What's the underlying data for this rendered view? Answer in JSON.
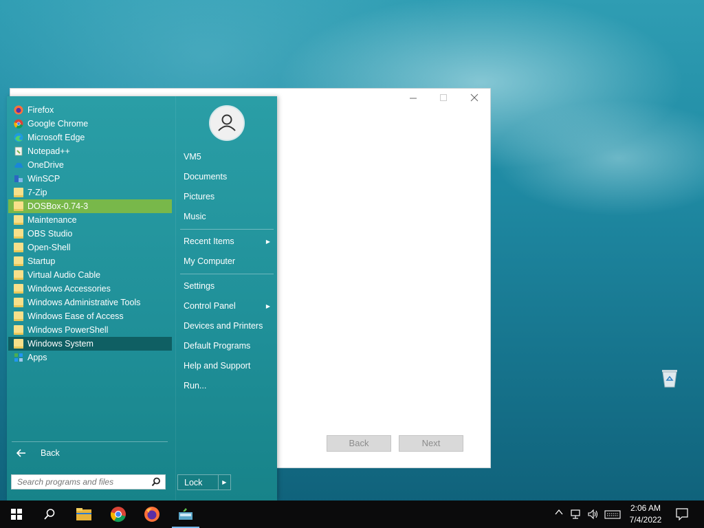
{
  "wizard": {
    "title": "",
    "back_label": "Back",
    "next_label": "Next"
  },
  "start_menu": {
    "programs": [
      {
        "label": "Firefox",
        "icon": "firefox-icon"
      },
      {
        "label": "Google Chrome",
        "icon": "chrome-icon"
      },
      {
        "label": "Microsoft Edge",
        "icon": "edge-icon"
      },
      {
        "label": "Notepad++",
        "icon": "notepad-plus-plus-icon"
      },
      {
        "label": "OneDrive",
        "icon": "onedrive-icon"
      },
      {
        "label": "WinSCP",
        "icon": "winscp-icon"
      },
      {
        "label": "7-Zip",
        "icon": "folder-icon"
      },
      {
        "label": "DOSBox-0.74-3",
        "icon": "folder-icon",
        "state": "highlighted"
      },
      {
        "label": "Maintenance",
        "icon": "folder-icon"
      },
      {
        "label": "OBS Studio",
        "icon": "folder-icon"
      },
      {
        "label": "Open-Shell",
        "icon": "folder-icon"
      },
      {
        "label": "Startup",
        "icon": "folder-icon"
      },
      {
        "label": "Virtual Audio Cable",
        "icon": "folder-icon"
      },
      {
        "label": "Windows Accessories",
        "icon": "folder-icon"
      },
      {
        "label": "Windows Administrative Tools",
        "icon": "folder-icon"
      },
      {
        "label": "Windows Ease of Access",
        "icon": "folder-icon"
      },
      {
        "label": "Windows PowerShell",
        "icon": "folder-icon"
      },
      {
        "label": "Windows System",
        "icon": "folder-icon",
        "state": "selected"
      },
      {
        "label": "Apps",
        "icon": "apps-icon"
      }
    ],
    "back_label": "Back",
    "search_placeholder": "Search programs and files",
    "right": {
      "user": "VM5",
      "documents": "Documents",
      "pictures": "Pictures",
      "music": "Music",
      "recent_items": "Recent Items",
      "my_computer": "My Computer",
      "settings": "Settings",
      "control_panel": "Control Panel",
      "devices_printers": "Devices and Printers",
      "default_programs": "Default Programs",
      "help_support": "Help and Support",
      "run": "Run..."
    },
    "lock_label": "Lock"
  },
  "taskbar": {
    "time": "2:06 AM",
    "date": "7/4/2022"
  },
  "colors": {
    "menu_bg": "#1f8f98",
    "highlight_green": "#78b84a",
    "selected_dark": "#0f5f63",
    "taskbar": "#0b0b0c"
  }
}
